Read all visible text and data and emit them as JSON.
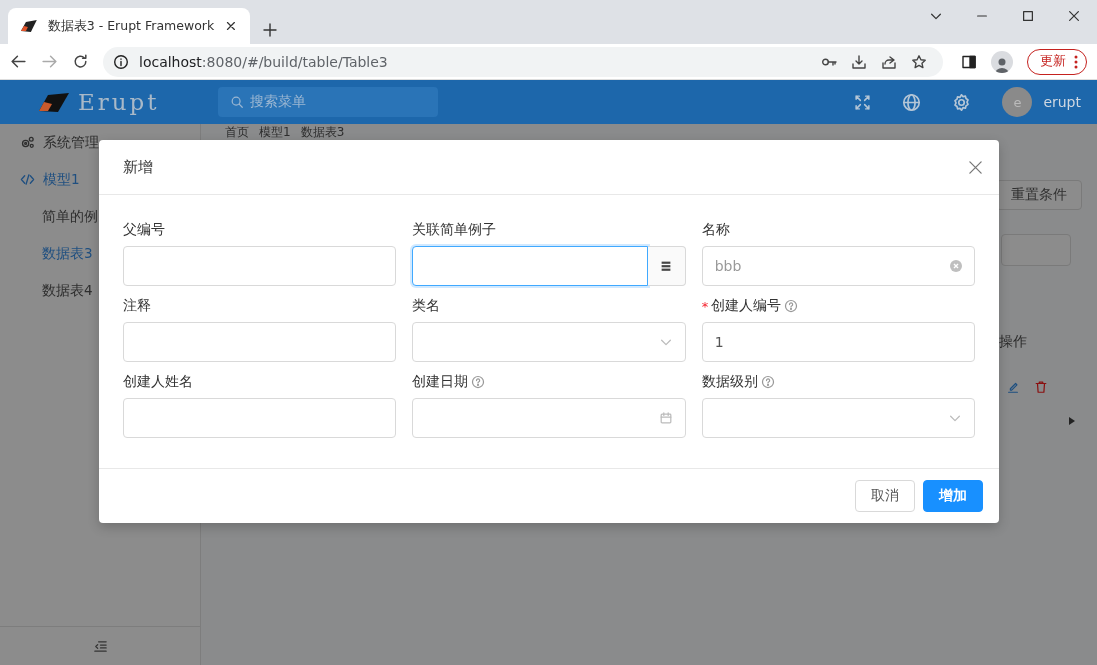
{
  "browser": {
    "tab": {
      "title": "数据表3 - Erupt Framework"
    },
    "url": {
      "host": "localhost",
      "rest": ":8080/#/build/table/Table3"
    },
    "update_button": "更新"
  },
  "header": {
    "logo": "Erupt",
    "search": {
      "placeholder": "搜索菜单"
    },
    "user": {
      "avatar": "e",
      "name": "erupt"
    }
  },
  "sidebar": {
    "items": [
      {
        "label": "系统管理",
        "expanded": false,
        "selected": false
      },
      {
        "label": "模型1",
        "expanded": true,
        "selected": false,
        "children": [
          {
            "label": "简单的例",
            "selected": false
          },
          {
            "label": "数据表3",
            "selected": true
          },
          {
            "label": "数据表4",
            "selected": false
          }
        ]
      }
    ]
  },
  "breadcrumb": [
    "首页",
    "模型1",
    "数据表3"
  ],
  "page": {
    "reset_button": "重置条件",
    "table": {
      "columns": [
        "操作"
      ]
    }
  },
  "dialog": {
    "title": "新增",
    "fields": [
      {
        "label": "父编号",
        "kind": "text",
        "required": false,
        "help": false,
        "focused": false
      },
      {
        "label": "关联简单例子",
        "kind": "reference",
        "required": false,
        "help": false,
        "focused": true
      },
      {
        "label": "名称",
        "kind": "text",
        "required": false,
        "help": false,
        "focused": false,
        "placeholder": "bbb",
        "clearable": true
      },
      {
        "label": "注释",
        "kind": "text",
        "required": false,
        "help": false,
        "focused": false
      },
      {
        "label": "类名",
        "kind": "select",
        "required": false,
        "help": false,
        "focused": false
      },
      {
        "label": "创建人编号",
        "kind": "text",
        "required": true,
        "required_mark": "*",
        "help": true,
        "focused": false,
        "value": "1"
      },
      {
        "label": "创建人姓名",
        "kind": "text",
        "required": false,
        "help": false,
        "focused": false
      },
      {
        "label": "创建日期",
        "kind": "date",
        "required": false,
        "help": true,
        "focused": false
      },
      {
        "label": "数据级别",
        "kind": "select",
        "required": false,
        "help": true,
        "focused": false
      }
    ],
    "buttons": [
      {
        "label": "取消",
        "kind": "default"
      },
      {
        "label": "增加",
        "kind": "primary"
      }
    ]
  }
}
